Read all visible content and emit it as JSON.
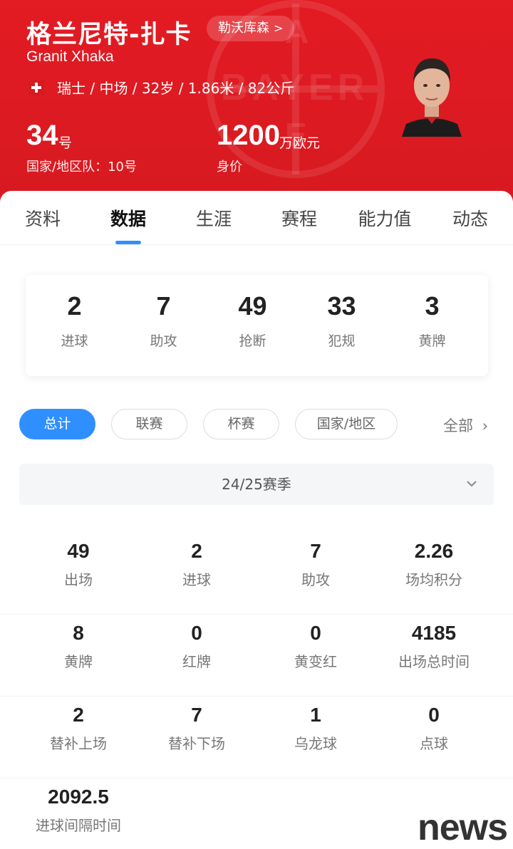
{
  "header": {
    "name_cn": "格兰尼特-扎卡",
    "club_label": "勒沃库森",
    "club_chevron": ">",
    "name_en": "Granit Xhaka",
    "info": "瑞士 / 中场 / 32岁 / 1.86米 / 82公斤",
    "shirt_number": "34",
    "shirt_unit": "号",
    "national_team": "国家/地区队：10号",
    "market_value": "1200",
    "market_unit": "万欧元",
    "market_label": "身价",
    "colors": {
      "primary": "#e31b23",
      "accent": "#2f8fff"
    }
  },
  "tabs": [
    {
      "label": "资料",
      "active": false
    },
    {
      "label": "数据",
      "active": true
    },
    {
      "label": "生涯",
      "active": false
    },
    {
      "label": "赛程",
      "active": false
    },
    {
      "label": "能力值",
      "active": false
    },
    {
      "label": "动态",
      "active": false
    }
  ],
  "summary": [
    {
      "value": "2",
      "label": "进球"
    },
    {
      "value": "7",
      "label": "助攻"
    },
    {
      "value": "49",
      "label": "抢断"
    },
    {
      "value": "33",
      "label": "犯规"
    },
    {
      "value": "3",
      "label": "黄牌"
    }
  ],
  "filters": [
    {
      "label": "总计",
      "active": true
    },
    {
      "label": "联赛",
      "active": false
    },
    {
      "label": "杯赛",
      "active": false
    },
    {
      "label": "国家/地区",
      "active": false
    }
  ],
  "all_label": "全部",
  "all_chevron": "›",
  "season": {
    "label": "24/25赛季",
    "dropdown_icon": "chevron-down-icon"
  },
  "stats": [
    {
      "value": "49",
      "label": "出场"
    },
    {
      "value": "2",
      "label": "进球"
    },
    {
      "value": "7",
      "label": "助攻"
    },
    {
      "value": "2.26",
      "label": "场均积分"
    },
    {
      "value": "8",
      "label": "黄牌"
    },
    {
      "value": "0",
      "label": "红牌"
    },
    {
      "value": "0",
      "label": "黄变红"
    },
    {
      "value": "4185",
      "label": "出场总时间"
    },
    {
      "value": "2",
      "label": "替补上场"
    },
    {
      "value": "7",
      "label": "替补下场"
    },
    {
      "value": "1",
      "label": "乌龙球"
    },
    {
      "value": "0",
      "label": "点球"
    },
    {
      "value": "2092.5",
      "label": "进球间隔时间"
    }
  ],
  "watermark": "news"
}
